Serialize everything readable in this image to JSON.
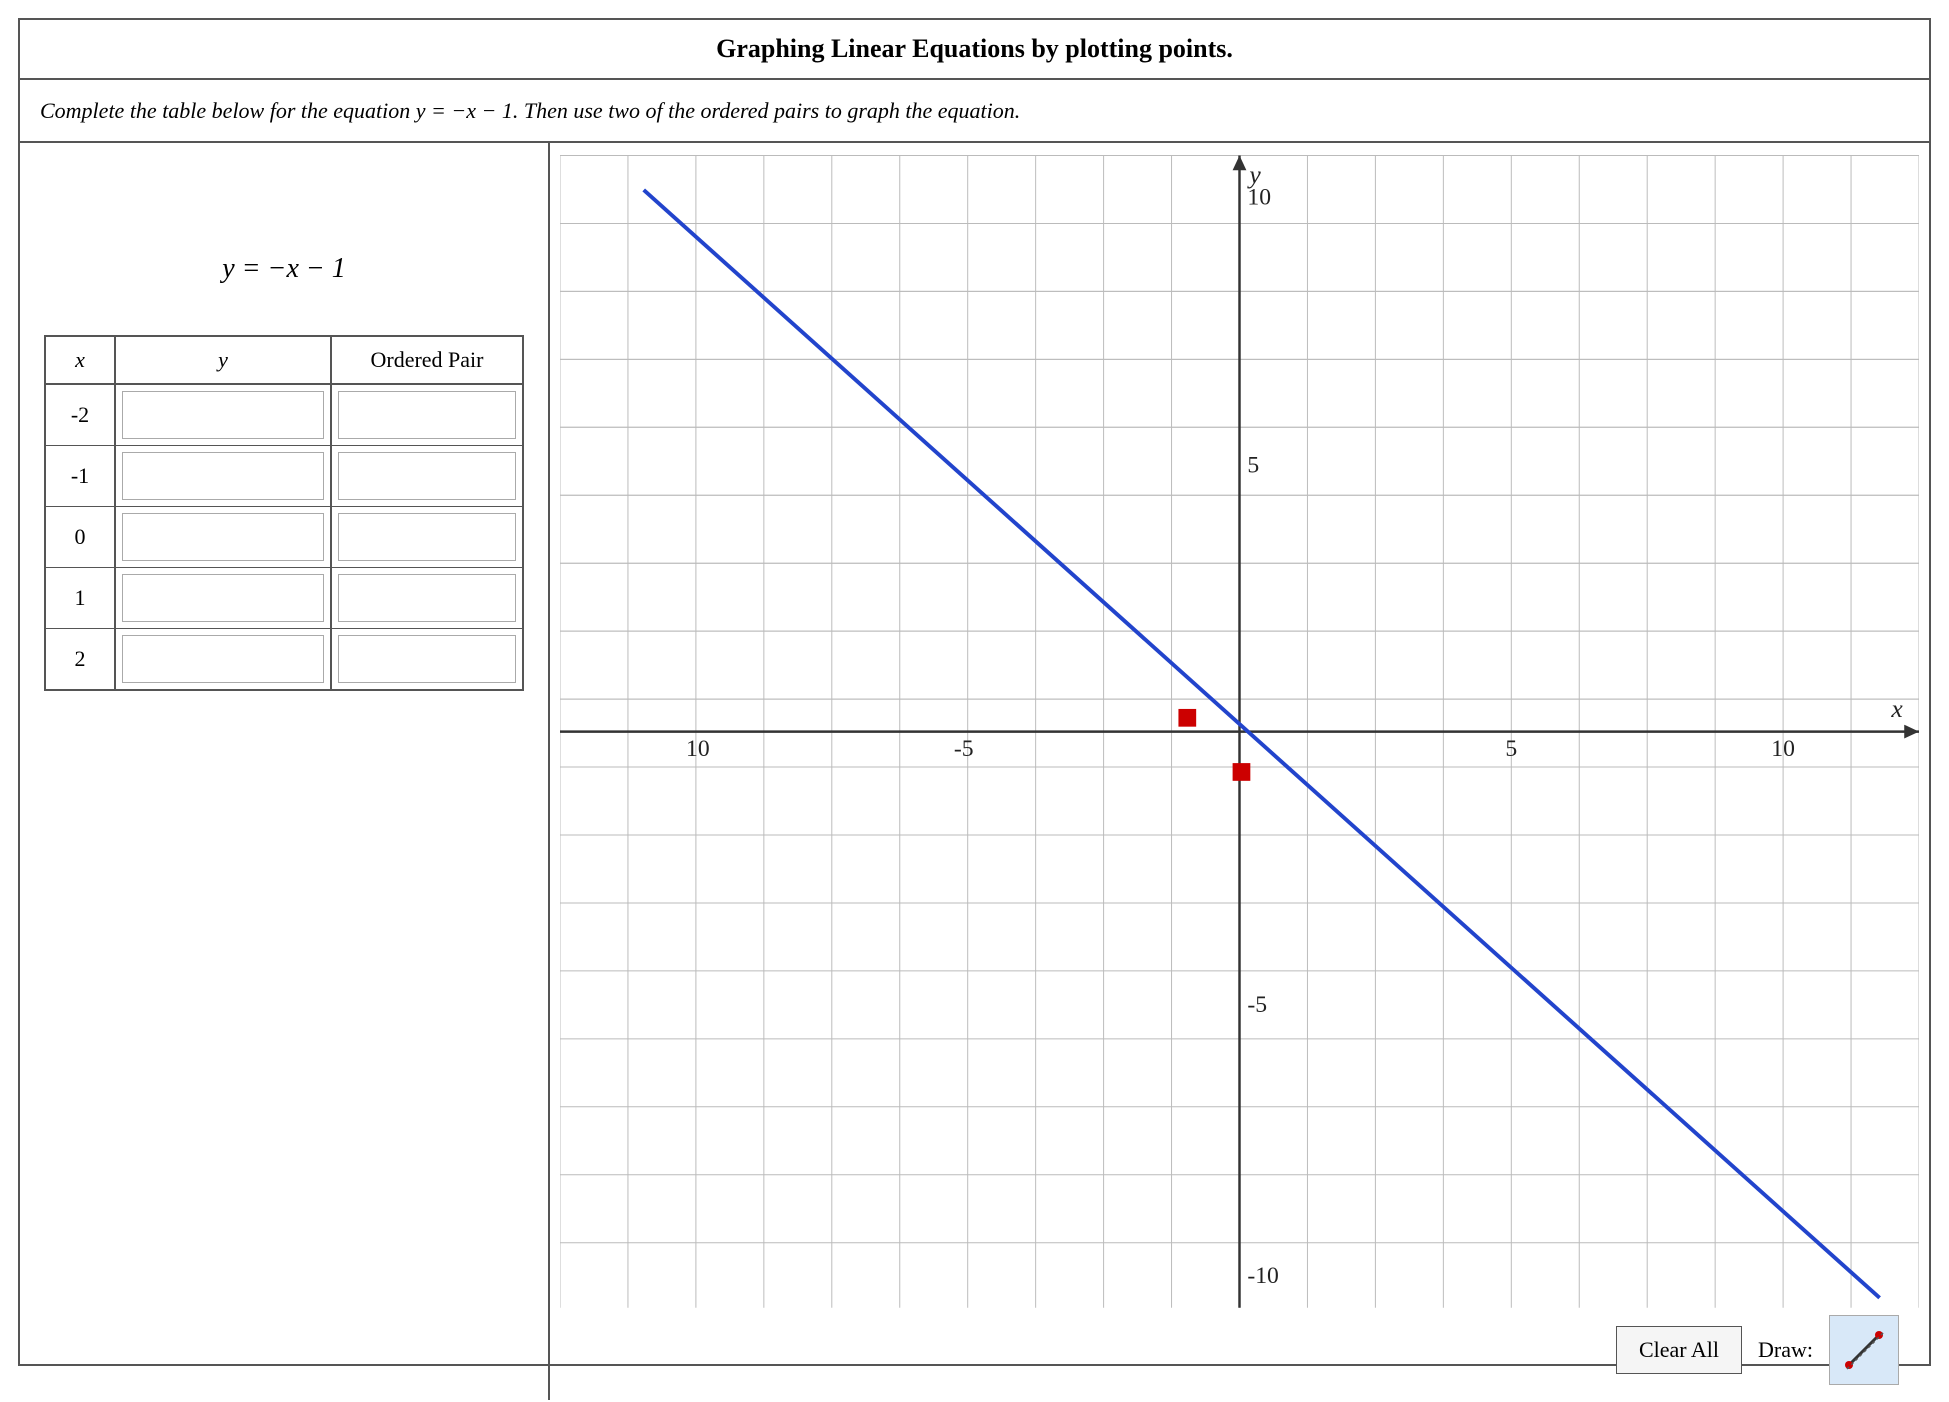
{
  "title": "Graphing Linear Equations by plotting points.",
  "instructions": "Complete the table below for the equation y = −x − 1. Then use two of the ordered pairs to graph the equation.",
  "equation": "y = −x − 1",
  "table": {
    "headers": [
      "x",
      "y",
      "Ordered Pair"
    ],
    "rows": [
      {
        "x": "-2",
        "y_val": "",
        "ordered_pair": ""
      },
      {
        "x": "-1",
        "y_val": "",
        "ordered_pair": ""
      },
      {
        "x": "0",
        "y_val": "",
        "ordered_pair": ""
      },
      {
        "x": "1",
        "y_val": "",
        "ordered_pair": ""
      },
      {
        "x": "2",
        "y_val": "",
        "ordered_pair": ""
      }
    ]
  },
  "graph": {
    "x_min": -10,
    "x_max": 10,
    "y_min": -10,
    "y_max": 10,
    "x_label": "x",
    "y_label": "y",
    "axis_labels": {
      "top": "10",
      "bottom": "-10",
      "left": "10",
      "right": "10",
      "mid_right": "5",
      "mid_left": "-5",
      "mid_top": "5",
      "mid_bottom": "-5"
    }
  },
  "buttons": {
    "clear_all": "Clear All",
    "draw_label": "Draw:"
  },
  "colors": {
    "line": "#2244cc",
    "points": "#cc0000",
    "grid": "#bbbbbb",
    "axis": "#333333"
  }
}
